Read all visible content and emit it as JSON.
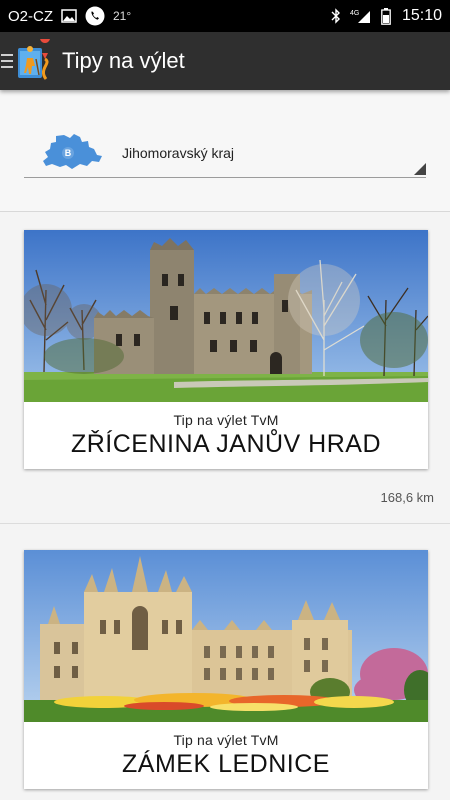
{
  "status_bar": {
    "carrier": "O2-CZ",
    "temperature": "21°",
    "network": "4G",
    "time": "15:10",
    "icons": [
      "image-icon",
      "phone-icon",
      "bluetooth-icon",
      "signal-icon",
      "battery-icon"
    ]
  },
  "app_bar": {
    "title": "Tipy na výlet",
    "icons": [
      "menu-icon",
      "hiker-map-logo-icon"
    ]
  },
  "region": {
    "map_letter": "B",
    "selected": "Jihomoravský kraj"
  },
  "trips": [
    {
      "subtitle": "Tip na výlet TvM",
      "title": "ZŘÍCENINA JANŮV HRAD",
      "distance": "168,6 km"
    },
    {
      "subtitle": "Tip na výlet TvM",
      "title": "ZÁMEK LEDNICE",
      "distance": ""
    }
  ],
  "colors": {
    "app_bar": "#2f2f2f",
    "status_bar": "#000000",
    "region_map": "#4a90d9",
    "background": "#f4f4f4"
  }
}
